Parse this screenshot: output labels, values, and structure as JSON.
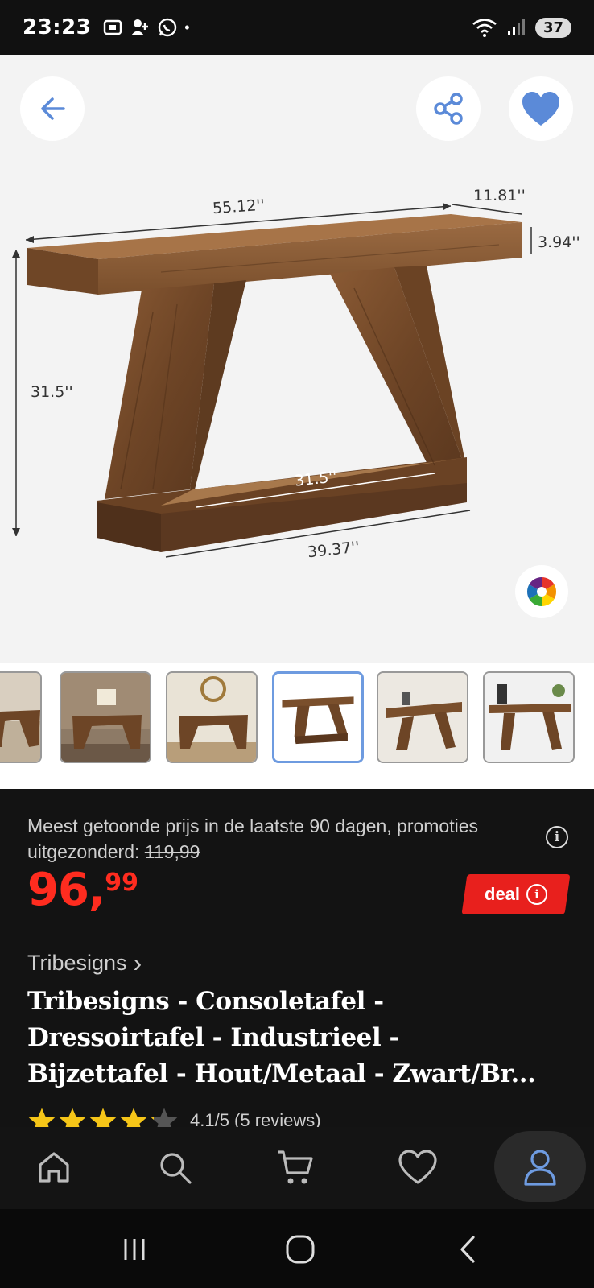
{
  "status_bar": {
    "time": "23:23",
    "dot": "•",
    "battery": "37"
  },
  "product_image": {
    "dimensions": {
      "width": "55.12''",
      "depth": "11.81''",
      "top_thickness": "3.94''",
      "height": "31.5''",
      "inner_width": "31.5''",
      "base_length": "39.37''"
    }
  },
  "thumbnails": {
    "count": 6,
    "active_index": 3
  },
  "pricing": {
    "lowest_price_text": "Meest getoonde prijs in de laatste 90 dagen, promoties uitgezonderd:",
    "old_price": "119,99",
    "price_main": "96,",
    "price_decimals": "99",
    "deal_label": "deal",
    "info_icon_glyph": "i"
  },
  "product": {
    "brand": "Tribesigns",
    "brand_chevron": "›",
    "title_line1": "Tribesigns - Consoletafel -",
    "title_line2": "Dressoirtafel - Industrieel -",
    "title_line3": "Bijzettafel - Hout/Metaal - Zwart/Br...",
    "rating": 4.1,
    "rating_text": "4.1/5 (5 reviews)"
  },
  "bottom_nav": {
    "items": [
      "home-icon",
      "search-icon",
      "cart-icon",
      "heart-icon",
      "account-icon"
    ],
    "active": "account-icon"
  },
  "colors": {
    "accent_blue": "#6e9be0",
    "price_red": "#ff2c1f",
    "deal_red": "#e8201d",
    "star_yellow": "#f5c518",
    "dark_bg": "#131313"
  }
}
